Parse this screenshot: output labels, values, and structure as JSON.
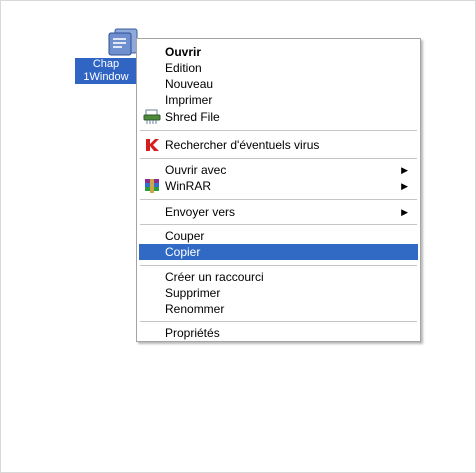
{
  "desktop_icon": {
    "label_line1": "Chap",
    "label_line2": "1Window",
    "icon": "document-file-icon"
  },
  "context_menu": {
    "items": [
      {
        "label": "Ouvrir",
        "bold": true
      },
      {
        "label": "Edition"
      },
      {
        "label": "Nouveau"
      },
      {
        "label": "Imprimer"
      },
      {
        "label": "Shred File",
        "icon": "shred-file-icon"
      },
      {
        "label": "Rechercher d'éventuels virus",
        "icon": "kaspersky-icon"
      },
      {
        "label": "Ouvrir avec",
        "submenu": true
      },
      {
        "label": "WinRAR",
        "icon": "winrar-icon",
        "submenu": true
      },
      {
        "label": "Envoyer vers",
        "submenu": true
      },
      {
        "label": "Couper"
      },
      {
        "label": "Copier",
        "selected": true
      },
      {
        "label": "Créer un raccourci"
      },
      {
        "label": "Supprimer"
      },
      {
        "label": "Renommer"
      },
      {
        "label": "Propriétés"
      }
    ],
    "submenu_arrow": "▶"
  },
  "colors": {
    "selection": "#316ac5",
    "label_highlight": "#3165c4",
    "separator": "#c5c5c5"
  }
}
